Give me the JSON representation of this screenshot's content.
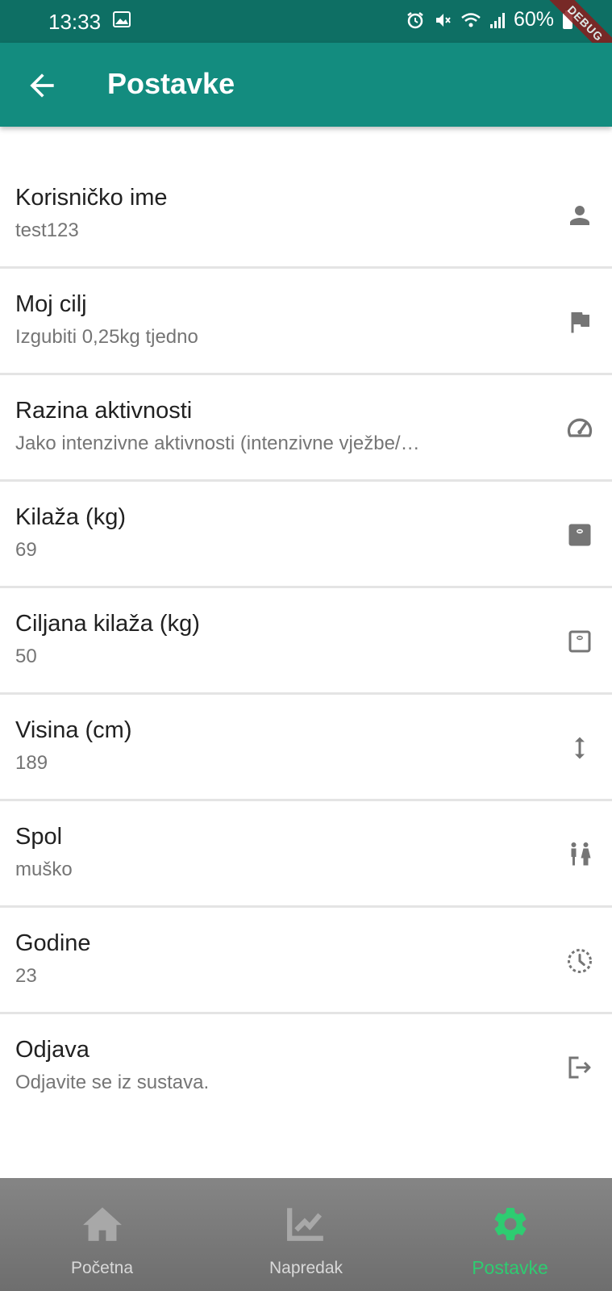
{
  "status_bar": {
    "time": "13:33",
    "battery": "60%"
  },
  "debug_banner": "DEBUG",
  "app_bar": {
    "title": "Postavke",
    "back_icon": "arrow-back-icon"
  },
  "settings": [
    {
      "title": "Korisničko ime",
      "subtitle": "test123",
      "icon": "person-icon"
    },
    {
      "title": "Moj cilj",
      "subtitle": "Izgubiti 0,25kg tjedno",
      "icon": "flag-icon"
    },
    {
      "title": "Razina aktivnosti",
      "subtitle": "Jako intenzivne aktivnosti (intenzivne vježbe/…",
      "icon": "speedometer-icon"
    },
    {
      "title": "Kilaža (kg)",
      "subtitle": "69",
      "icon": "scale-icon"
    },
    {
      "title": "Ciljana kilaža (kg)",
      "subtitle": "50",
      "icon": "scale-outline-icon"
    },
    {
      "title": "Visina (cm)",
      "subtitle": "189",
      "icon": "height-icon"
    },
    {
      "title": "Spol",
      "subtitle": "muško",
      "icon": "gender-icon"
    },
    {
      "title": "Godine",
      "subtitle": "23",
      "icon": "age-clock-icon"
    },
    {
      "title": "Odjava",
      "subtitle": "Odjavite se iz sustava.",
      "icon": "logout-icon"
    }
  ],
  "bottom_nav": {
    "items": [
      {
        "label": "Početna",
        "icon": "home-icon"
      },
      {
        "label": "Napredak",
        "icon": "chart-icon"
      },
      {
        "label": "Postavke",
        "icon": "gear-icon",
        "active": true
      }
    ]
  },
  "colors": {
    "app_bar": "#138c7f",
    "status_bar": "#0e6f64",
    "active_nav": "#2ecc71",
    "icon_gray": "#757575"
  }
}
